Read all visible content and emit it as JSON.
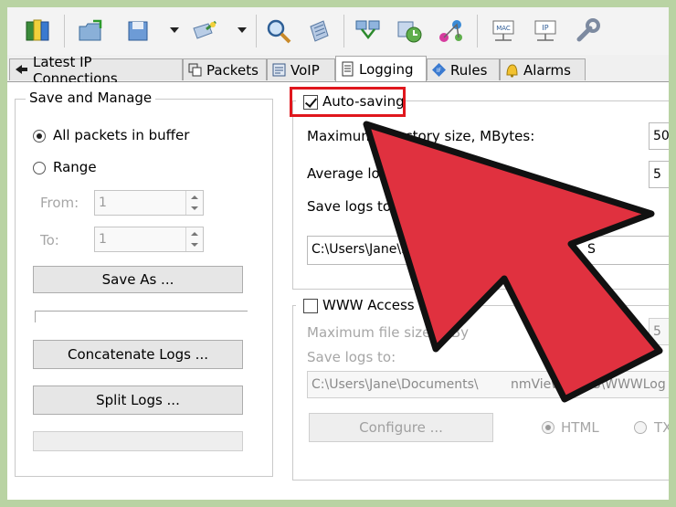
{
  "tabs": [
    {
      "label": "Latest IP Connections",
      "icon": "connections-icon"
    },
    {
      "label": "Packets",
      "icon": "packets-icon"
    },
    {
      "label": "VoIP",
      "icon": "voip-icon"
    },
    {
      "label": "Logging",
      "icon": "logging-icon",
      "active": true
    },
    {
      "label": "Rules",
      "icon": "rules-icon"
    },
    {
      "label": "Alarms",
      "icon": "alarms-icon"
    }
  ],
  "save_manage": {
    "title": "Save and Manage",
    "all_packets_label": "All packets in buffer",
    "range_label": "Range",
    "from_label": "From:",
    "from_value": "1",
    "to_label": "To:",
    "to_value": "1",
    "save_as_label": "Save As ...",
    "concatenate_label": "Concatenate Logs ...",
    "split_label": "Split Logs ..."
  },
  "autosave": {
    "label": "Auto-saving",
    "checked": true,
    "max_dir_label": "Maximum directory size, MBytes:",
    "max_dir_value": "50",
    "avg_log_label": "Average log",
    "avg_log_value": "5",
    "save_to_label": "Save logs to:",
    "path_left": "C:\\Users\\Jane\\Do",
    "path_right": "S"
  },
  "www": {
    "label": "WWW Access Logg",
    "max_file_label": "Maximum file size, MBy",
    "max_file_value": "5",
    "save_to_label": "Save logs to:",
    "path_left": "C:\\Users\\Jane\\Documents\\",
    "path_right": "nmView\\LOGS\\WWWLog",
    "configure_label": "Configure ...",
    "html_label": "HTML",
    "tx_label": "TX"
  },
  "colors": {
    "highlight": "#e0171d",
    "arrow": "#e0313f"
  }
}
